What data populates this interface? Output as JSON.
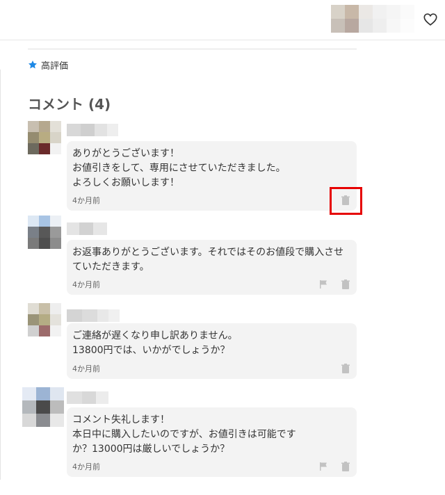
{
  "rating": {
    "label": "高評価"
  },
  "comments_heading": "コメント (4)",
  "comments": [
    {
      "text": "ありがとうございます！\nお値引きをして、専用にさせていただきました。\nよろしくお願いします！",
      "time": "4か月前"
    },
    {
      "text": "お返事ありがとうございます。それではそのお値段で購入させていただきます。",
      "time": "4か月前"
    },
    {
      "text": "ご連絡が遅くなり申し訳ありません。\n13800円では、いかがでしょうか？",
      "time": "4か月前"
    },
    {
      "text": "コメント失礼します！\n本日中に購入したいのですが、お値引きは可能です\nか？13000円は厳しいでしょうか？",
      "time": "4か月前"
    }
  ],
  "icons": {
    "rating": "star-icon",
    "favorite": "heart-icon",
    "flag": "flag-icon",
    "delete": "trash-icon"
  },
  "colors": {
    "star": "#1e88e5",
    "highlight": "#e60000",
    "bubble": "#f3f3f3"
  }
}
